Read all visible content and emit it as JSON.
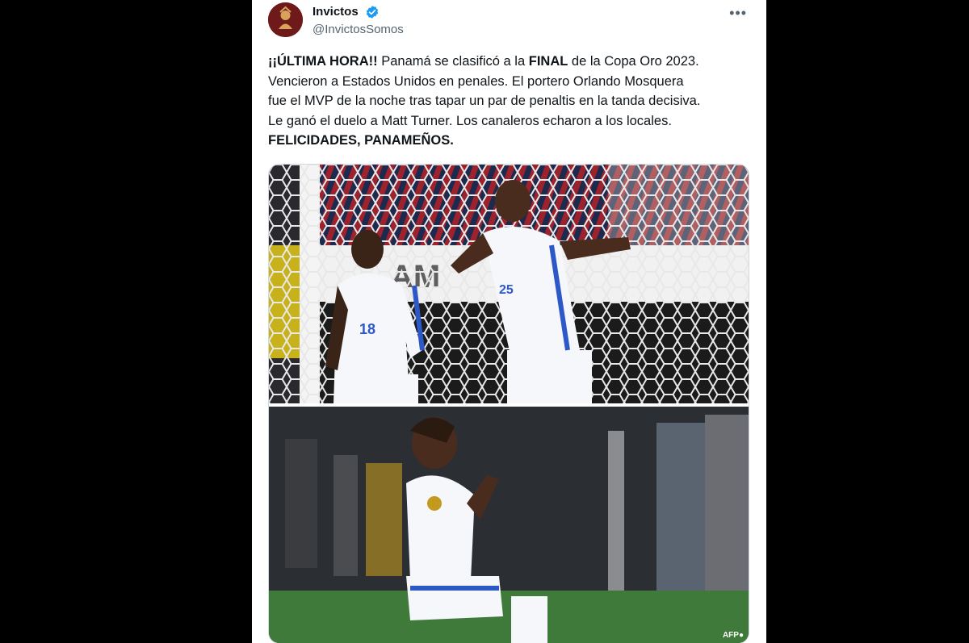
{
  "author": {
    "name": "Invictos",
    "handle": "@InvictosSomos",
    "verified_icon": "verified-badge-icon",
    "avatar_icon": "invictos-logo-avatar"
  },
  "menu": {
    "icon": "more-options-icon",
    "label": "•••"
  },
  "tweet": {
    "p1": "¡¡ÚLTIMA HORA!!",
    "p2": " Panamá se clasificó a la ",
    "p3": "FINAL",
    "p4": " de la Copa Oro 2023.",
    "line2": "Vencieron a Estados Unidos en penales. El portero Orlando Mosquera",
    "line3": "fue el MVP de la noche tras tapar un par de penaltis en la tanda decisiva.",
    "line4": "Le ganó el duelo a Matt Turner. Los canaleros echaron a los locales.",
    "line5": "FELICIDADES, PANAMEÑOS."
  },
  "media": {
    "top_photo_icon": "players-celebrating-photo",
    "bottom_photo_icon": "player-kneeling-photo",
    "credit": "AFP●"
  },
  "colors": {
    "verified": "#1d9bf0",
    "text": "#0f1419",
    "muted": "#536471"
  }
}
